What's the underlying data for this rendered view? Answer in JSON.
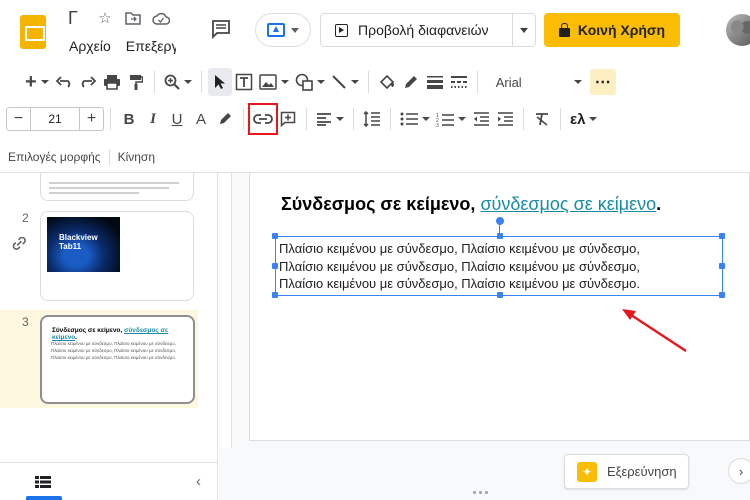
{
  "app": {
    "title_fragment": "Γ",
    "menus": [
      "Αρχείο",
      "Επεξεργ"
    ]
  },
  "header": {
    "slideshow_label": "Προβολή διαφανειών",
    "share_label": "Κοινή Χρήση"
  },
  "toolbar2": {
    "font_size": "21",
    "font_name": "Arial",
    "lang_label": "ελ"
  },
  "format_bar": {
    "format_options": "Επιλογές μορφής",
    "motion": "Κίνηση"
  },
  "filmstrip": {
    "slide2_num": "2",
    "slide2_caption": "Blackview Tab11",
    "slide3_num": "3",
    "slide3_title_plain": "Σύνδεσμος σε κείμενο, ",
    "slide3_title_link": "σύνδεσμος σε κείμενο",
    "slide3_title_end": "."
  },
  "slide": {
    "title_plain": "Σύνδεσμος σε κείμενο, ",
    "title_link": "σύνδεσμος σε κείμενο",
    "title_end": ".",
    "body_lines": [
      "Πλαίσιο κειμένου με σύνδεσμο, Πλαίσιο κειμένου με σύνδεσμο,",
      "Πλαίσιο κειμένου με σύνδεσμο, Πλαίσιο κειμένου με σύνδεσμο,",
      "Πλαίσιο κειμένου με σύνδεσμο, Πλαίσιο κειμένου με σύνδεσμο."
    ],
    "thumb_lines": [
      "Πλαίσιο κειμένου με σύνδεσμο, Πλαίσιο κειμένου με σύνδεσμο,",
      "Πλαίσιο κειμένου με σύνδεσμο, Πλαίσιο κειμένου με σύνδεσμο,",
      "Πλαίσιο κειμένου με σύνδεσμο, Πλαίσιο κειμένου με σύνδεσμο."
    ]
  },
  "explore": {
    "label": "Εξερεύνηση"
  },
  "colors": {
    "accent": "#1a73e8",
    "share": "#fbbc04",
    "link": "#1a8ba5",
    "highlight": "#e6181e"
  }
}
